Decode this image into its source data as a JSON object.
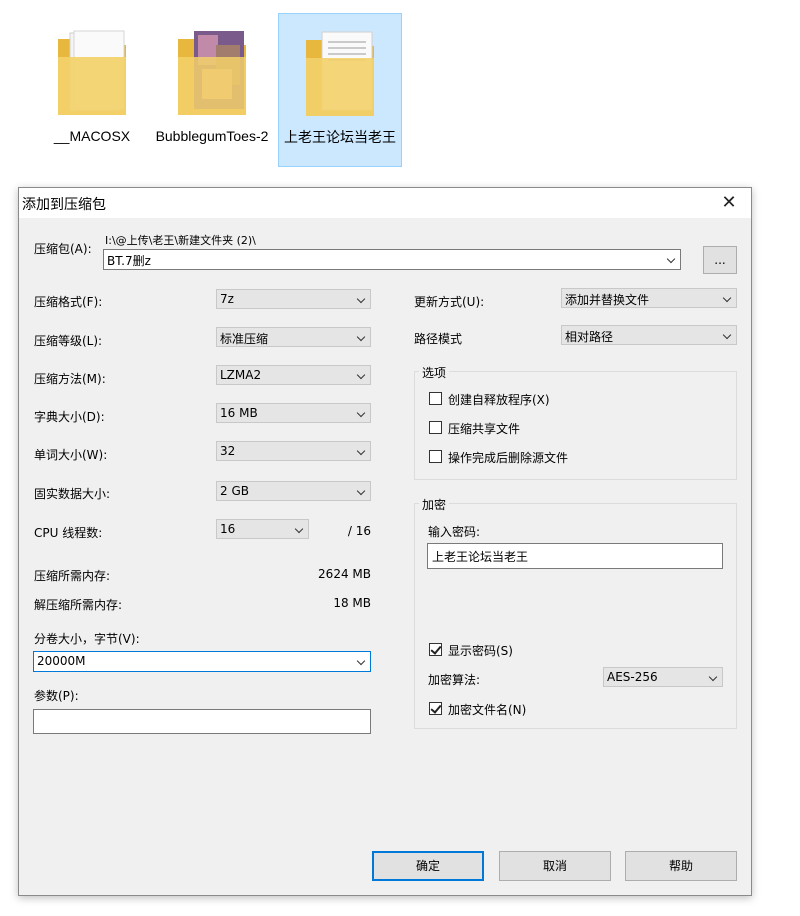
{
  "desktop": {
    "folders": [
      {
        "name": "__MACOSX",
        "selected": false
      },
      {
        "name": "BubblegumToes-2",
        "selected": false
      },
      {
        "name": "上老王论坛当老王",
        "selected": true
      }
    ]
  },
  "dialog": {
    "title": "添加到压缩包",
    "close_icon": "close-icon",
    "archive": {
      "label": "压缩包(A):",
      "path": "I:\\@上传\\老王\\新建文件夹 (2)\\",
      "name": "BT.7删z",
      "browse_label": "..."
    },
    "left": {
      "format": {
        "label": "压缩格式(F):",
        "value": "7z"
      },
      "level": {
        "label": "压缩等级(L):",
        "value": "标准压缩"
      },
      "method": {
        "label": "压缩方法(M):",
        "value": "LZMA2"
      },
      "dict": {
        "label": "字典大小(D):",
        "value": "16 MB"
      },
      "word": {
        "label": "单词大小(W):",
        "value": "32"
      },
      "solid": {
        "label": "固实数据大小:",
        "value": "2 GB"
      },
      "cpu": {
        "label": "CPU 线程数:",
        "value": "16",
        "total": "/ 16"
      },
      "mem_compress": {
        "label": "压缩所需内存:",
        "value": "2624 MB"
      },
      "mem_decompress": {
        "label": "解压缩所需内存:",
        "value": "18 MB"
      },
      "volume": {
        "label": "分卷大小，字节(V):",
        "value": "20000M"
      },
      "params": {
        "label": "参数(P):",
        "value": ""
      }
    },
    "right": {
      "update": {
        "label": "更新方式(U):",
        "value": "添加并替换文件"
      },
      "path_mode": {
        "label": "路径模式",
        "value": "相对路径"
      },
      "options": {
        "title": "选项",
        "sfx": {
          "label": "创建自释放程序(X)",
          "checked": false
        },
        "shared": {
          "label": "压缩共享文件",
          "checked": false
        },
        "delete": {
          "label": "操作完成后删除源文件",
          "checked": false
        }
      },
      "encryption": {
        "title": "加密",
        "password_label": "输入密码:",
        "password_value": "上老王论坛当老王",
        "show_password": {
          "label": "显示密码(S)",
          "checked": true
        },
        "method_label": "加密算法:",
        "method_value": "AES-256",
        "encrypt_names": {
          "label": "加密文件名(N)",
          "checked": true
        }
      }
    },
    "buttons": {
      "ok": "确定",
      "cancel": "取消",
      "help": "帮助"
    }
  }
}
